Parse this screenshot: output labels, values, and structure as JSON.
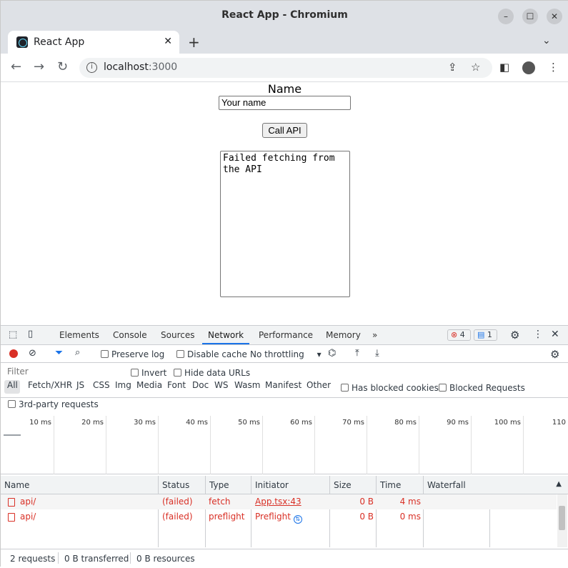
{
  "window": {
    "title": "React App - Chromium"
  },
  "tab": {
    "title": "React App",
    "close": "✕"
  },
  "address": {
    "host": "localhost",
    "port": ":3000"
  },
  "page": {
    "name_label": "Name",
    "name_placeholder": "Your name",
    "call_button": "Call API",
    "output": "Failed fetching from the API"
  },
  "devtools": {
    "tabs": [
      "Elements",
      "Console",
      "Sources",
      "Network",
      "Performance",
      "Memory"
    ],
    "more": "»",
    "errors": "4",
    "messages": "1",
    "preserve_log": "Preserve log",
    "disable_cache": "Disable cache",
    "throttling": "No throttling",
    "filter_placeholder": "Filter",
    "invert": "Invert",
    "hide_data_urls": "Hide data URLs",
    "filters": [
      "All",
      "Fetch/XHR",
      "JS",
      "CSS",
      "Img",
      "Media",
      "Font",
      "Doc",
      "WS",
      "Wasm",
      "Manifest",
      "Other"
    ],
    "has_blocked_cookies": "Has blocked cookies",
    "blocked_requests": "Blocked Requests",
    "third_party": "3rd-party requests",
    "ticks": [
      "10 ms",
      "20 ms",
      "30 ms",
      "40 ms",
      "50 ms",
      "60 ms",
      "70 ms",
      "80 ms",
      "90 ms",
      "100 ms",
      "110"
    ],
    "columns": [
      "Name",
      "Status",
      "Type",
      "Initiator",
      "Size",
      "Time",
      "Waterfall"
    ],
    "rows": [
      {
        "name": "api/",
        "status": "(failed)",
        "type": "fetch",
        "initiator": "App.tsx:43",
        "size": "0 B",
        "time": "4 ms"
      },
      {
        "name": "api/",
        "status": "(failed)",
        "type": "preflight",
        "initiator": "Preflight",
        "size": "0 B",
        "time": "0 ms"
      }
    ],
    "summary": {
      "requests": "2 requests",
      "transferred": "0 B transferred",
      "resources": "0 B resources"
    }
  }
}
